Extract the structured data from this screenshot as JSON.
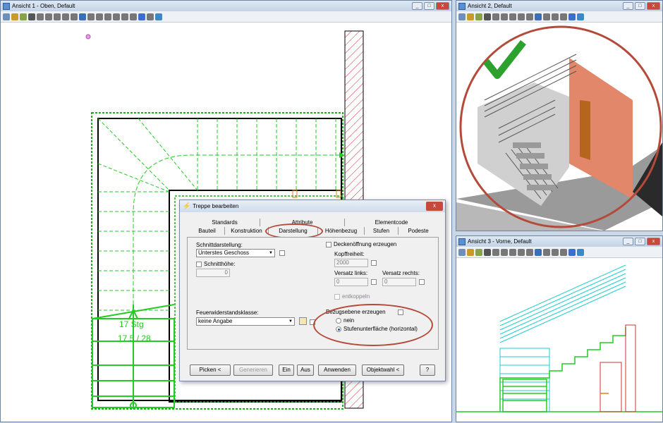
{
  "view1": {
    "title": "Ansicht 1 - Oben, Default",
    "stair_text1": "17 Stg",
    "stair_text2": "17,5 / 28"
  },
  "view2": {
    "title": "Ansicht 2, Default"
  },
  "view3": {
    "title": "Ansicht 3 - Vorne, Default"
  },
  "window_buttons": {
    "minimize": "_",
    "maximize": "□",
    "close": "x"
  },
  "dialog": {
    "title": "Treppe bearbeiten",
    "close": "x",
    "tabs_back": [
      "Standards",
      "Attribute",
      "Elementcode"
    ],
    "tabs_front": [
      "Bauteil",
      "Konstruktion",
      "Darstellung",
      "Höhenbezug",
      "Stufen",
      "Podeste"
    ],
    "schnittdarstellung_label": "Schnittdarstellung:",
    "schnittdarstellung_value": "Unterstes Geschoss",
    "schnitthoehe_label": "Schnitthöhe:",
    "schnitthoehe_value": "0",
    "feuer_label": "Feuerwiderstandsklasse:",
    "feuer_value": "keine Angabe",
    "deckenoeffnung_label": "Deckenöffnung erzeugen",
    "kopffreiheit_label": "Kopffreiheit:",
    "kopffreiheit_value": "2000",
    "versatz_links_label": "Versatz links:",
    "versatz_links_value": "0",
    "versatz_rechts_label": "Versatz rechts:",
    "versatz_rechts_value": "0",
    "entkoppeln_label": "entkoppeln",
    "bezugsebene_label": "Bezugsebene erzeugen",
    "radio_nein": "nein",
    "radio_stufen": "Stufenunterfläche (horizontal)",
    "buttons": [
      "Picken <",
      "Generieren",
      "Ein",
      "Aus",
      "Anwenden",
      "Objektwahl <",
      "?"
    ]
  },
  "colors": {
    "accent_red": "#b34a3a",
    "stair_green": "#22cc22",
    "stair_cyan": "#22cccc"
  }
}
